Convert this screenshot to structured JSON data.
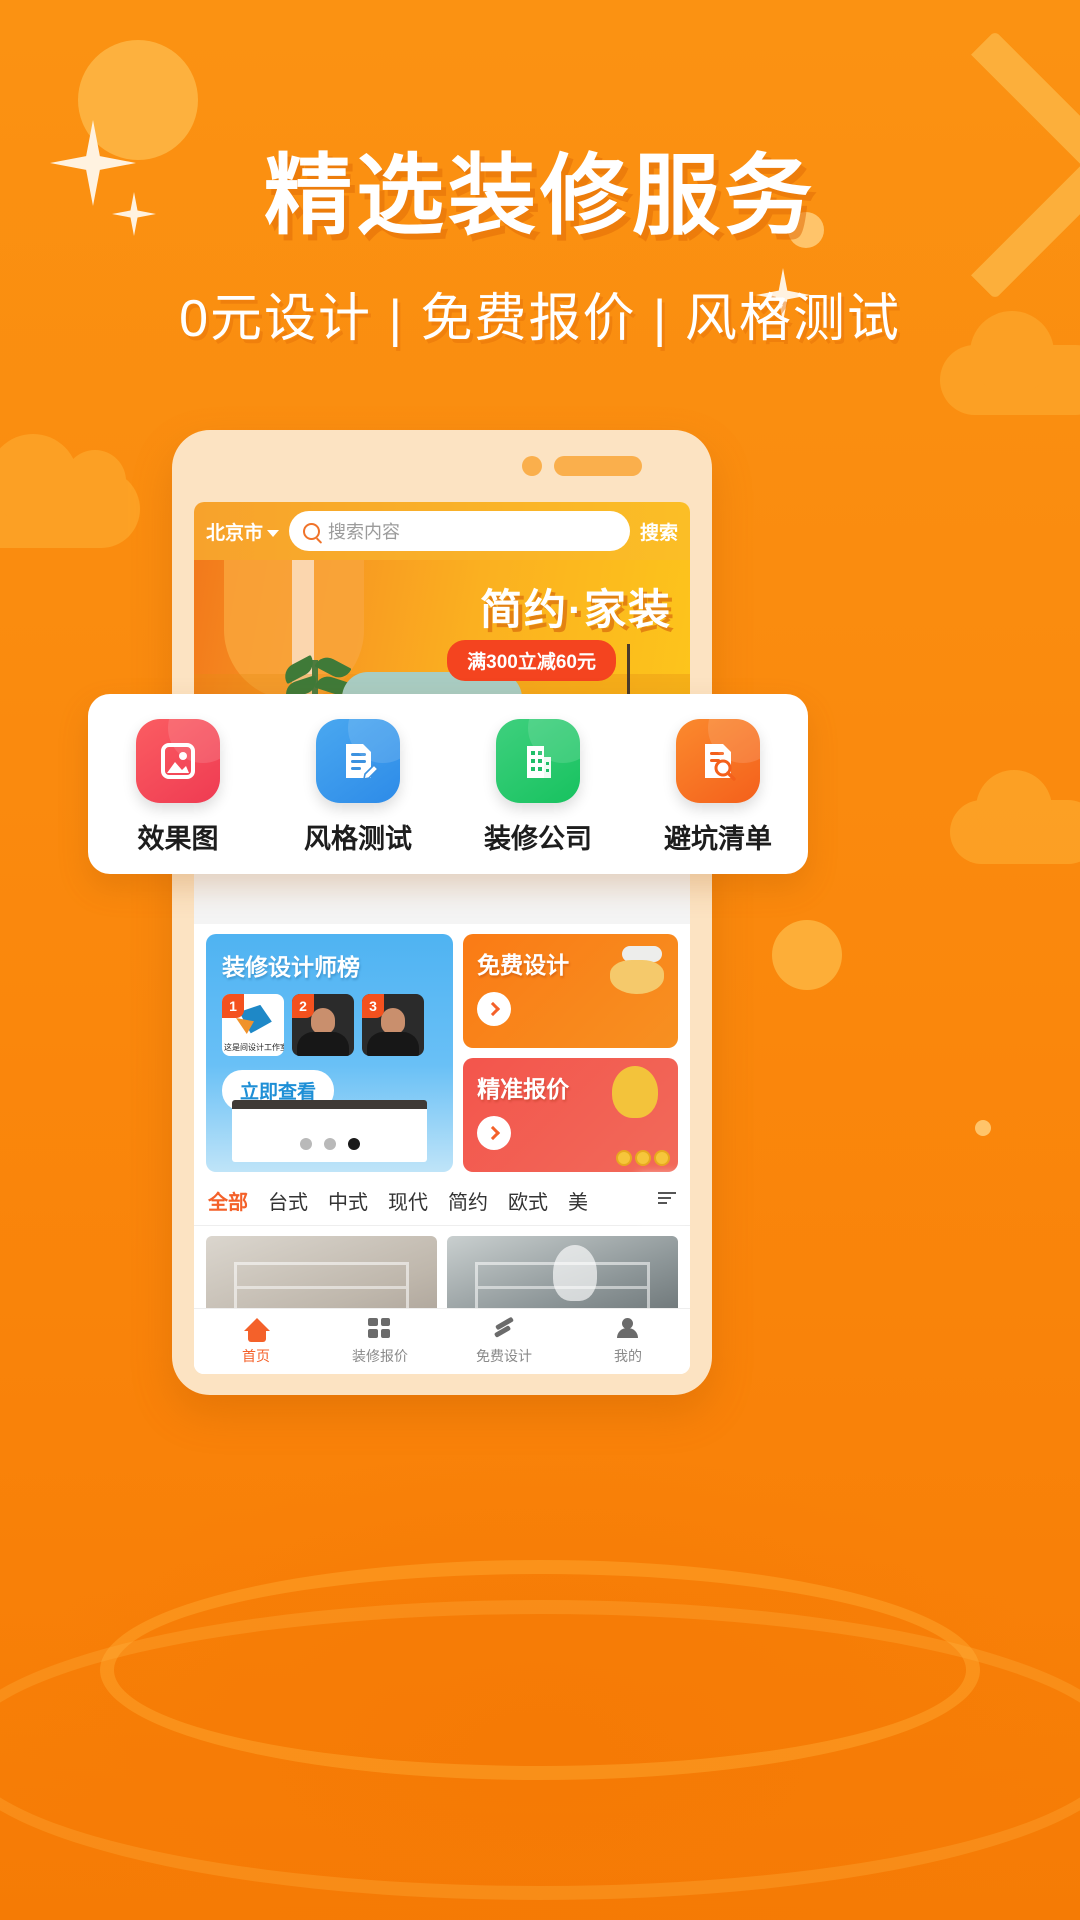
{
  "hero": {
    "title": "精选装修服务",
    "subtitle": "0元设计 | 免费报价 | 风格测试"
  },
  "colors": {
    "background": "#FA8C10",
    "accent": "#F4612A",
    "banner_badge": "#F4441F",
    "icon_red": "#EF3B52",
    "icon_blue": "#2D8BE8",
    "icon_green": "#17C25F",
    "icon_orange": "#F4601B"
  },
  "feature_card": {
    "items": [
      {
        "label": "效果图",
        "icon": "image-icon",
        "color": "red"
      },
      {
        "label": "风格测试",
        "icon": "document-edit-icon",
        "color": "blue"
      },
      {
        "label": "装修公司",
        "icon": "building-icon",
        "color": "green"
      },
      {
        "label": "避坑清单",
        "icon": "document-search-icon",
        "color": "orange"
      }
    ]
  },
  "phone": {
    "appbar": {
      "city": "北京市",
      "search_placeholder": "搜索内容",
      "search_value": "",
      "search_button": "搜索",
      "search_icon": "search-icon",
      "city_caret_icon": "chevron-down-icon"
    },
    "banner": {
      "title": "简约·家装",
      "badge": "满300立减60元"
    },
    "promo": {
      "rank_card": {
        "title": "装修设计师榜",
        "button": "立即查看",
        "ranks": [
          "1",
          "2",
          "3"
        ],
        "first_caption": "这是间设计工作室"
      },
      "free_design": {
        "title": "免费设计",
        "arrow_icon": "chevron-right-icon"
      },
      "accurate_quote": {
        "title": "精准报价",
        "arrow_icon": "chevron-right-icon"
      }
    },
    "tabs": {
      "items": [
        "全部",
        "台式",
        "中式",
        "现代",
        "简约",
        "欧式",
        "美"
      ],
      "active_index": 0,
      "more_icon": "filter-list-icon"
    },
    "nav": {
      "items": [
        {
          "label": "首页",
          "icon": "home-icon",
          "active": true
        },
        {
          "label": "装修报价",
          "icon": "calculator-icon",
          "active": false
        },
        {
          "label": "免费设计",
          "icon": "pencil-ruler-icon",
          "active": false
        },
        {
          "label": "我的",
          "icon": "user-icon",
          "active": false
        }
      ]
    }
  }
}
